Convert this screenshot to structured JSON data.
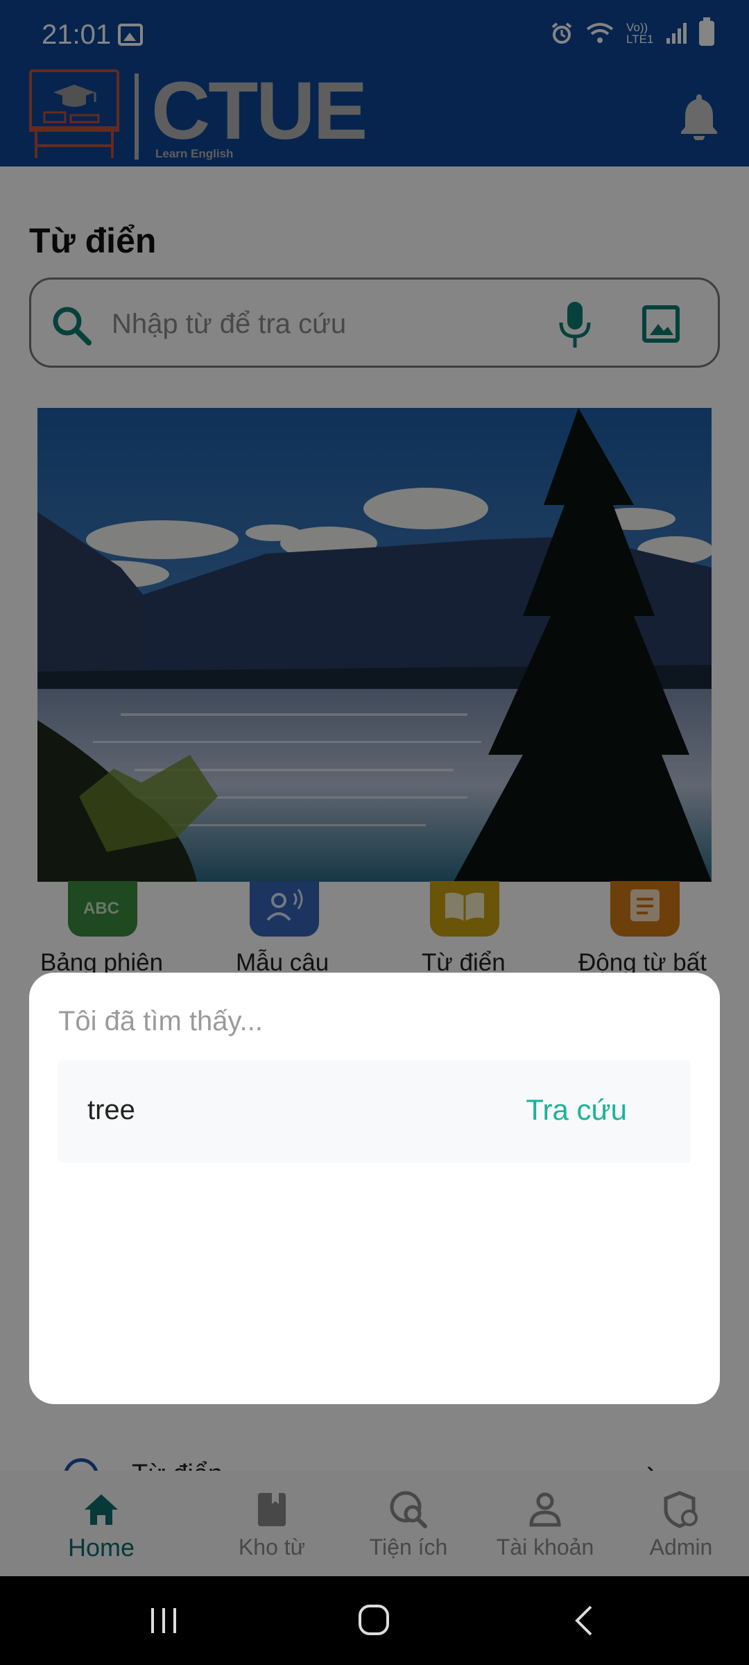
{
  "status_bar": {
    "time": "21:01",
    "network_label": "Vo)) LTE1"
  },
  "header": {
    "logo_text": "CTUE",
    "logo_subtitle": "Learn English"
  },
  "dictionary": {
    "title": "Từ điển",
    "search": {
      "placeholder": "Nhập từ để tra cứu",
      "value": ""
    }
  },
  "shortcuts": [
    {
      "label": "Bảng phiên",
      "color": "#43a047",
      "icon": "abc-icon"
    },
    {
      "label": "Mẫu câu",
      "color": "#3b76d6",
      "icon": "speaking-person-icon"
    },
    {
      "label": "Từ điển",
      "color": "#e6b800",
      "icon": "book-icon"
    },
    {
      "label": "Động từ bất",
      "color": "#ef8c12",
      "icon": "document-icon"
    }
  ],
  "list_item": {
    "label": "Từ điển"
  },
  "dialog": {
    "title": "Tôi đã tìm thấy...",
    "results": [
      {
        "word": "tree",
        "action": "Tra cứu"
      }
    ]
  },
  "bottom_nav": [
    {
      "label": "Home",
      "icon": "home-icon",
      "active": true
    },
    {
      "label": "Kho từ",
      "icon": "book-icon",
      "active": false
    },
    {
      "label": "Tiện ích",
      "icon": "globe-search-icon",
      "active": false
    },
    {
      "label": "Tài khoản",
      "icon": "person-icon",
      "active": false
    },
    {
      "label": "Admin",
      "icon": "admin-shield-icon",
      "active": false
    }
  ],
  "colors": {
    "header": "#0d4596",
    "accent": "#19b39a",
    "active_nav": "#0f6e6e"
  }
}
